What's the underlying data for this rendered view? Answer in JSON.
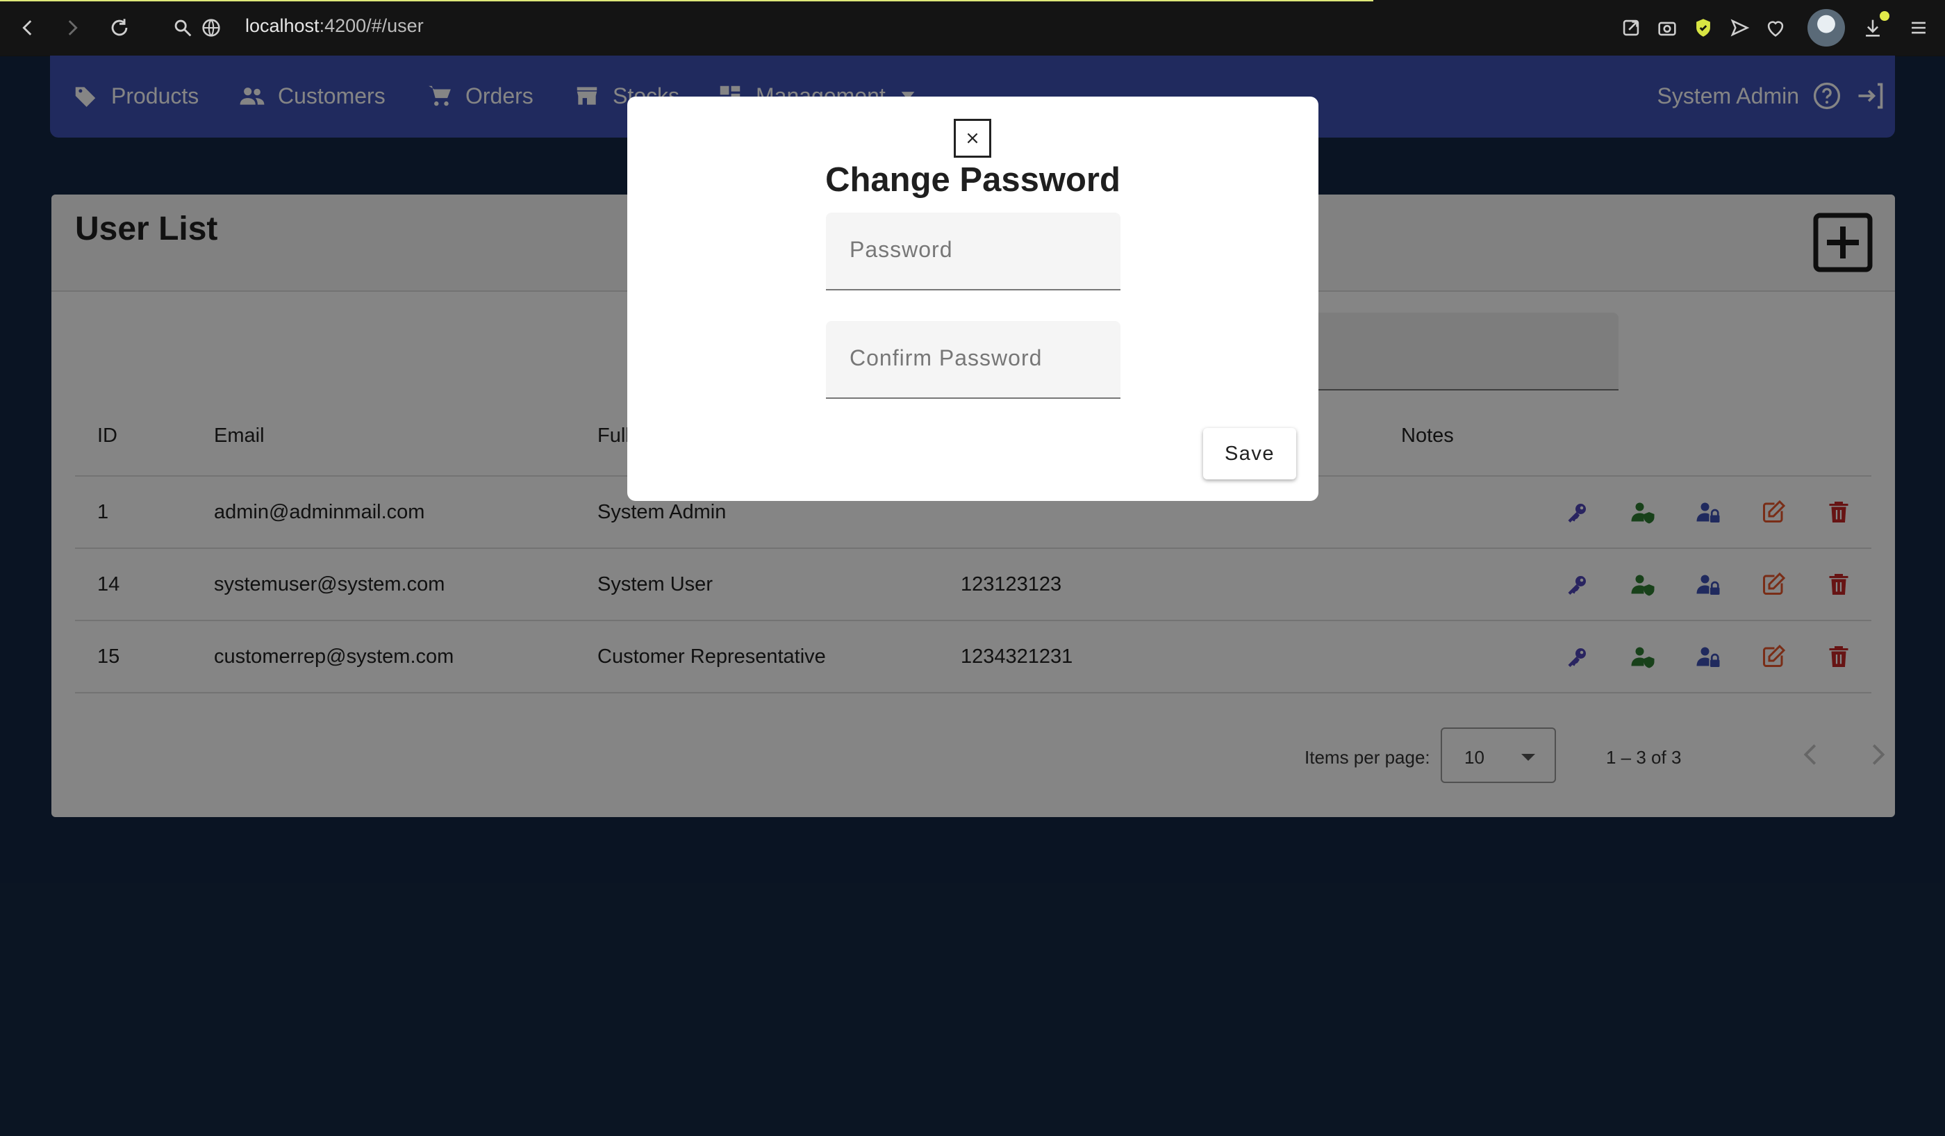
{
  "browser": {
    "url_host": "localhost",
    "url_path": ":4200/#/user"
  },
  "nav": {
    "items": [
      {
        "label": "Products",
        "icon": "tag-icon"
      },
      {
        "label": "Customers",
        "icon": "people-icon"
      },
      {
        "label": "Orders",
        "icon": "cart-icon"
      },
      {
        "label": "Stocks",
        "icon": "store-icon"
      },
      {
        "label": "Management",
        "icon": "dashboard-icon"
      }
    ],
    "user_name": "System Admin"
  },
  "page": {
    "title": "User List"
  },
  "table": {
    "columns": [
      "ID",
      "Email",
      "Full",
      "",
      "Notes"
    ],
    "rows": [
      {
        "id": "1",
        "email": "admin@adminmail.com",
        "full_name": "System Admin",
        "phone": "",
        "notes": ""
      },
      {
        "id": "14",
        "email": "systemuser@system.com",
        "full_name": "System User",
        "phone": "123123123",
        "notes": ""
      },
      {
        "id": "15",
        "email": "customerrep@system.com",
        "full_name": "Customer Representative",
        "phone": "1234321231",
        "notes": ""
      }
    ],
    "action_icons": [
      "key-icon",
      "user-shield-icon",
      "user-lock-icon",
      "edit-icon",
      "trash-icon"
    ]
  },
  "paginator": {
    "items_per_page_label": "Items per page:",
    "items_per_page_value": "10",
    "range_label": "1 – 3 of 3"
  },
  "modal": {
    "close_label": "×",
    "title": "Change Password",
    "password_placeholder": "Password",
    "confirm_placeholder": "Confirm Password",
    "save_label": "Save"
  },
  "colors": {
    "primary": "#3f51b5",
    "background": "#152844",
    "action_purple": "#3f51b5",
    "action_green": "#2e7d32",
    "action_orange": "#e8572c",
    "action_red": "#c62828"
  }
}
